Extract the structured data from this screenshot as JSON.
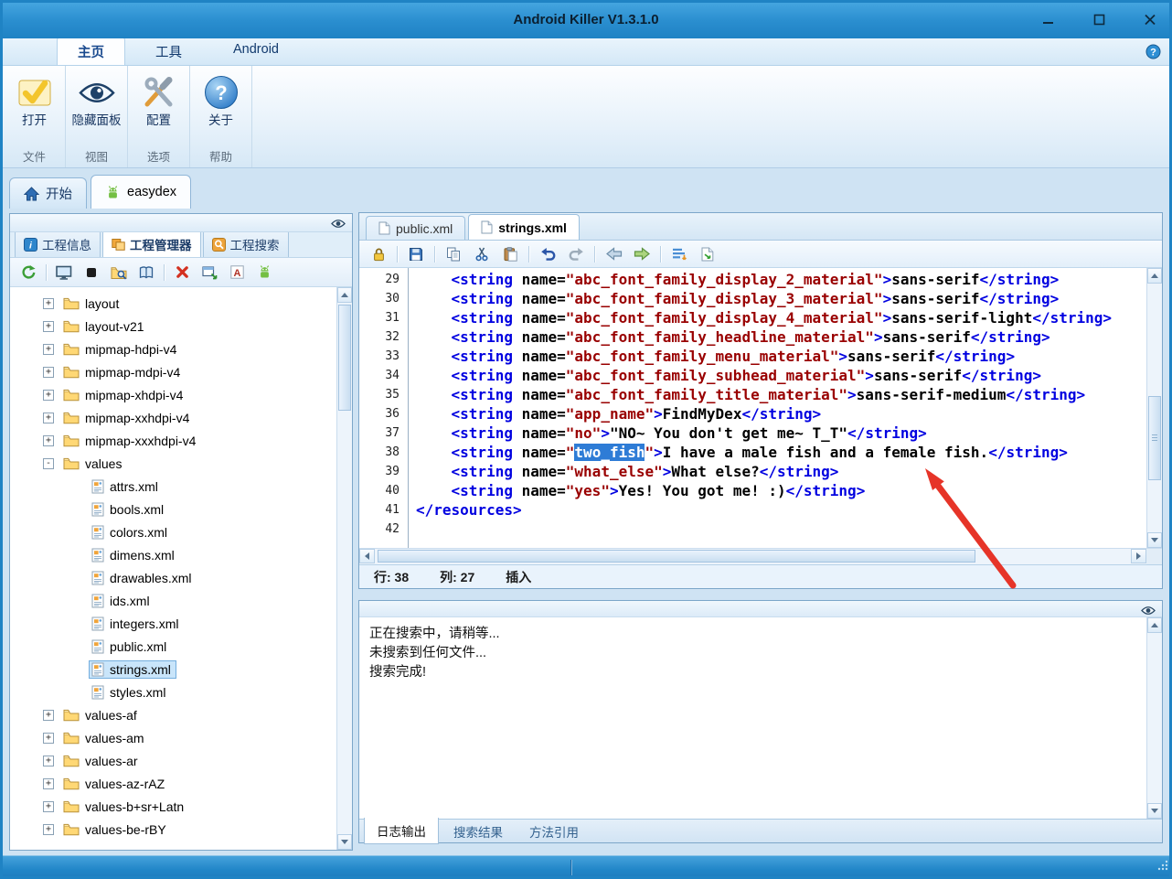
{
  "colors": {
    "titlebar": "#2a8ecf",
    "selection": "#2e7cd6",
    "xml_tag": "#0000e0",
    "xml_value": "#990000",
    "arrow": "#e63428"
  },
  "window": {
    "title": "Android Killer V1.3.1.0",
    "controls": [
      "minimize-icon",
      "maximize-icon",
      "close-icon"
    ]
  },
  "ribbon": {
    "tabs": [
      {
        "id": "home",
        "label": "主页",
        "active": true
      },
      {
        "id": "tools",
        "label": "工具",
        "active": false
      },
      {
        "id": "android",
        "label": "Android",
        "active": false
      }
    ],
    "help_icon": "help-icon",
    "groups": [
      {
        "id": "file",
        "button": "打开",
        "icon": "open-icon",
        "group_label": "文件"
      },
      {
        "id": "view",
        "button": "隐藏面板",
        "icon": "eye-big-icon",
        "group_label": "视图"
      },
      {
        "id": "options",
        "button": "配置",
        "icon": "config-icon",
        "group_label": "选项"
      },
      {
        "id": "help",
        "button": "关于",
        "icon": "about-icon",
        "group_label": "帮助"
      }
    ]
  },
  "document_tabs": [
    {
      "id": "start",
      "label": "开始",
      "icon": "home-icon",
      "active": false
    },
    {
      "id": "easydex",
      "label": "easydex",
      "icon": "android-icon",
      "active": true
    }
  ],
  "project_panel": {
    "tabs": [
      {
        "id": "project-info",
        "label": "工程信息",
        "icon": "info-icon",
        "active": false
      },
      {
        "id": "project-manager",
        "label": "工程管理器",
        "icon": "manager-icon",
        "active": true
      },
      {
        "id": "project-search",
        "label": "工程搜索",
        "icon": "search-icon",
        "active": false
      }
    ],
    "toolbar_icons": [
      "refresh-icon",
      "sep",
      "screen-icon",
      "stop-icon",
      "folder-search-icon",
      "book-icon",
      "sep",
      "delete-icon",
      "new-window-icon",
      "letter-a-icon",
      "android-icon"
    ],
    "tree": [
      {
        "label": "layout",
        "type": "folder",
        "level": 0,
        "expander": "+"
      },
      {
        "label": "layout-v21",
        "type": "folder",
        "level": 0,
        "expander": "+"
      },
      {
        "label": "mipmap-hdpi-v4",
        "type": "folder",
        "level": 0,
        "expander": "+"
      },
      {
        "label": "mipmap-mdpi-v4",
        "type": "folder",
        "level": 0,
        "expander": "+"
      },
      {
        "label": "mipmap-xhdpi-v4",
        "type": "folder",
        "level": 0,
        "expander": "+"
      },
      {
        "label": "mipmap-xxhdpi-v4",
        "type": "folder",
        "level": 0,
        "expander": "+"
      },
      {
        "label": "mipmap-xxxhdpi-v4",
        "type": "folder",
        "level": 0,
        "expander": "+"
      },
      {
        "label": "values",
        "type": "folder",
        "level": 0,
        "expander": "-"
      },
      {
        "label": "attrs.xml",
        "type": "file",
        "level": 1
      },
      {
        "label": "bools.xml",
        "type": "file",
        "level": 1
      },
      {
        "label": "colors.xml",
        "type": "file",
        "level": 1
      },
      {
        "label": "dimens.xml",
        "type": "file",
        "level": 1
      },
      {
        "label": "drawables.xml",
        "type": "file",
        "level": 1
      },
      {
        "label": "ids.xml",
        "type": "file",
        "level": 1
      },
      {
        "label": "integers.xml",
        "type": "file",
        "level": 1
      },
      {
        "label": "public.xml",
        "type": "file",
        "level": 1
      },
      {
        "label": "strings.xml",
        "type": "file",
        "level": 1,
        "selected": true
      },
      {
        "label": "styles.xml",
        "type": "file",
        "level": 1
      },
      {
        "label": "values-af",
        "type": "folder",
        "level": 0,
        "expander": "+"
      },
      {
        "label": "values-am",
        "type": "folder",
        "level": 0,
        "expander": "+"
      },
      {
        "label": "values-ar",
        "type": "folder",
        "level": 0,
        "expander": "+"
      },
      {
        "label": "values-az-rAZ",
        "type": "folder",
        "level": 0,
        "expander": "+"
      },
      {
        "label": "values-b+sr+Latn",
        "type": "folder",
        "level": 0,
        "expander": "+"
      },
      {
        "label": "values-be-rBY",
        "type": "folder",
        "level": 0,
        "expander": "+"
      }
    ]
  },
  "editor": {
    "tabs": [
      {
        "id": "public-xml",
        "label": "public.xml",
        "icon": "page-icon",
        "active": false
      },
      {
        "id": "strings-xml",
        "label": "strings.xml",
        "icon": "page-icon",
        "active": true
      }
    ],
    "toolbar_icons": [
      "lock-icon",
      "sep",
      "save-icon",
      "sep",
      "copy-icon",
      "cut-icon",
      "paste-icon",
      "sep",
      "undo-icon",
      "redo-icon",
      "sep",
      "back-icon",
      "forward-icon",
      "sep",
      "format-icon",
      "export-icon"
    ],
    "lines": [
      {
        "num": 29,
        "tokens": [
          [
            "p",
            "    "
          ],
          [
            "t",
            "<string"
          ],
          [
            "p",
            " "
          ],
          [
            "a",
            "name="
          ],
          [
            "v",
            "\"abc_font_family_display_2_material\""
          ],
          [
            "t",
            ">"
          ],
          [
            "p",
            "sans-serif"
          ],
          [
            "t",
            "</string>"
          ]
        ]
      },
      {
        "num": 30,
        "tokens": [
          [
            "p",
            "    "
          ],
          [
            "t",
            "<string"
          ],
          [
            "p",
            " "
          ],
          [
            "a",
            "name="
          ],
          [
            "v",
            "\"abc_font_family_display_3_material\""
          ],
          [
            "t",
            ">"
          ],
          [
            "p",
            "sans-serif"
          ],
          [
            "t",
            "</string>"
          ]
        ]
      },
      {
        "num": 31,
        "tokens": [
          [
            "p",
            "    "
          ],
          [
            "t",
            "<string"
          ],
          [
            "p",
            " "
          ],
          [
            "a",
            "name="
          ],
          [
            "v",
            "\"abc_font_family_display_4_material\""
          ],
          [
            "t",
            ">"
          ],
          [
            "p",
            "sans-serif-light"
          ],
          [
            "t",
            "</string>"
          ]
        ]
      },
      {
        "num": 32,
        "tokens": [
          [
            "p",
            "    "
          ],
          [
            "t",
            "<string"
          ],
          [
            "p",
            " "
          ],
          [
            "a",
            "name="
          ],
          [
            "v",
            "\"abc_font_family_headline_material\""
          ],
          [
            "t",
            ">"
          ],
          [
            "p",
            "sans-serif"
          ],
          [
            "t",
            "</string>"
          ]
        ]
      },
      {
        "num": 33,
        "tokens": [
          [
            "p",
            "    "
          ],
          [
            "t",
            "<string"
          ],
          [
            "p",
            " "
          ],
          [
            "a",
            "name="
          ],
          [
            "v",
            "\"abc_font_family_menu_material\""
          ],
          [
            "t",
            ">"
          ],
          [
            "p",
            "sans-serif"
          ],
          [
            "t",
            "</string>"
          ]
        ]
      },
      {
        "num": 34,
        "tokens": [
          [
            "p",
            "    "
          ],
          [
            "t",
            "<string"
          ],
          [
            "p",
            " "
          ],
          [
            "a",
            "name="
          ],
          [
            "v",
            "\"abc_font_family_subhead_material\""
          ],
          [
            "t",
            ">"
          ],
          [
            "p",
            "sans-serif"
          ],
          [
            "t",
            "</string>"
          ]
        ]
      },
      {
        "num": 35,
        "tokens": [
          [
            "p",
            "    "
          ],
          [
            "t",
            "<string"
          ],
          [
            "p",
            " "
          ],
          [
            "a",
            "name="
          ],
          [
            "v",
            "\"abc_font_family_title_material\""
          ],
          [
            "t",
            ">"
          ],
          [
            "p",
            "sans-serif-medium"
          ],
          [
            "t",
            "</string>"
          ]
        ]
      },
      {
        "num": 36,
        "tokens": [
          [
            "p",
            "    "
          ],
          [
            "t",
            "<string"
          ],
          [
            "p",
            " "
          ],
          [
            "a",
            "name="
          ],
          [
            "v",
            "\"app_name\""
          ],
          [
            "t",
            ">"
          ],
          [
            "p",
            "FindMyDex"
          ],
          [
            "t",
            "</string>"
          ]
        ]
      },
      {
        "num": 37,
        "tokens": [
          [
            "p",
            "    "
          ],
          [
            "t",
            "<string"
          ],
          [
            "p",
            " "
          ],
          [
            "a",
            "name="
          ],
          [
            "v",
            "\"no\""
          ],
          [
            "t",
            ">"
          ],
          [
            "p",
            "\"NO~ You don't get me~ T_T\""
          ],
          [
            "t",
            "</string>"
          ]
        ]
      },
      {
        "num": 38,
        "tokens": [
          [
            "p",
            "    "
          ],
          [
            "t",
            "<string"
          ],
          [
            "p",
            " "
          ],
          [
            "a",
            "name="
          ],
          [
            "v",
            "\""
          ],
          [
            "s",
            "two_fish"
          ],
          [
            "v",
            "\""
          ],
          [
            "t",
            ">"
          ],
          [
            "p",
            "I have a male fish and a female fish."
          ],
          [
            "t",
            "</string>"
          ]
        ]
      },
      {
        "num": 39,
        "tokens": [
          [
            "p",
            "    "
          ],
          [
            "t",
            "<string"
          ],
          [
            "p",
            " "
          ],
          [
            "a",
            "name="
          ],
          [
            "v",
            "\"what_else\""
          ],
          [
            "t",
            ">"
          ],
          [
            "p",
            "What else?"
          ],
          [
            "t",
            "</string>"
          ]
        ]
      },
      {
        "num": 40,
        "tokens": [
          [
            "p",
            "    "
          ],
          [
            "t",
            "<string"
          ],
          [
            "p",
            " "
          ],
          [
            "a",
            "name="
          ],
          [
            "v",
            "\"yes\""
          ],
          [
            "t",
            ">"
          ],
          [
            "p",
            "Yes! You got me! :)"
          ],
          [
            "t",
            "</string>"
          ]
        ]
      },
      {
        "num": 41,
        "tokens": [
          [
            "t",
            "</resources>"
          ]
        ]
      },
      {
        "num": 42,
        "tokens": []
      }
    ],
    "status": {
      "line": "行: 38",
      "column": "列: 27",
      "mode": "插入"
    }
  },
  "log_panel": {
    "lines": [
      "正在搜索中，请稍等...",
      "未搜索到任何文件...",
      "搜索完成!"
    ],
    "tabs": [
      {
        "id": "log-output",
        "label": "日志输出",
        "active": true
      },
      {
        "id": "search-results",
        "label": "搜索结果",
        "active": false
      },
      {
        "id": "method-references",
        "label": "方法引用",
        "active": false
      }
    ]
  }
}
